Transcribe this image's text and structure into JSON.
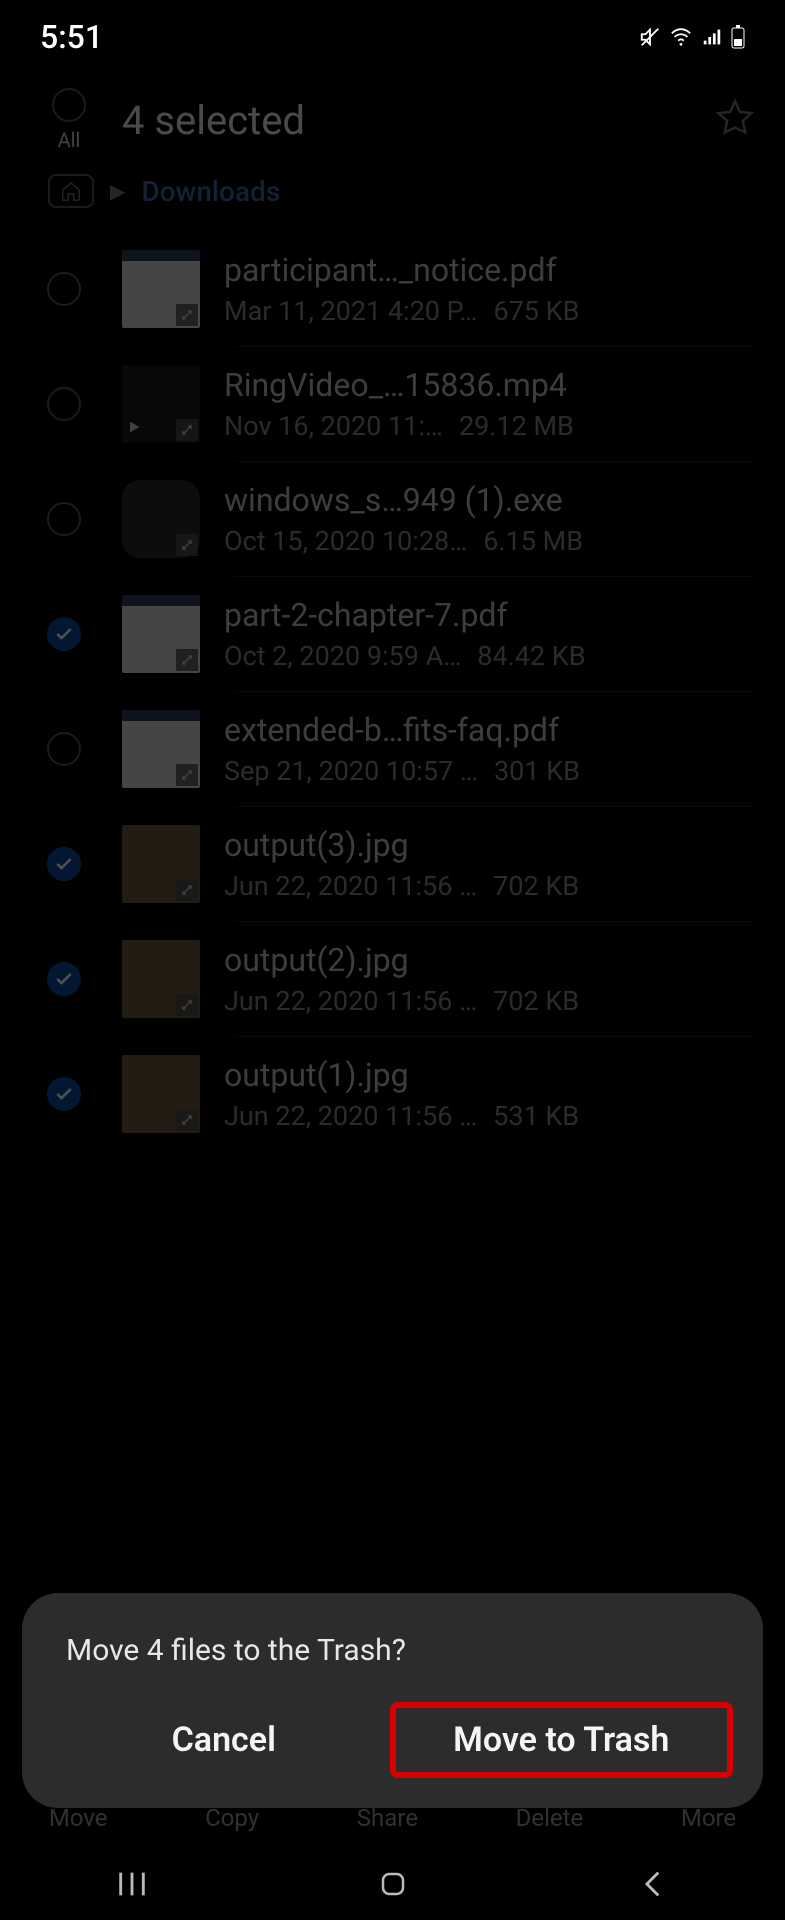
{
  "status": {
    "time": "5:51"
  },
  "header": {
    "title": "4 selected",
    "all_label": "All"
  },
  "breadcrumb": {
    "current": "Downloads"
  },
  "files": [
    {
      "name": "participant…_notice.pdf",
      "date": "Mar 11, 2021 4:20 P…",
      "size": "675 KB",
      "selected": false,
      "kind": "doc"
    },
    {
      "name": "RingVideo_…15836.mp4",
      "date": "Nov 16, 2020 11:…",
      "size": "29.12 MB",
      "selected": false,
      "kind": "vid"
    },
    {
      "name": "windows_s…949 (1).exe",
      "date": "Oct 15, 2020 10:28…",
      "size": "6.15 MB",
      "selected": false,
      "kind": "exe"
    },
    {
      "name": "part-2-chapter-7.pdf",
      "date": "Oct 2, 2020 9:59 A…",
      "size": "84.42 KB",
      "selected": true,
      "kind": "doc"
    },
    {
      "name": "extended-b…fits-faq.pdf",
      "date": "Sep 21, 2020 10:57 …",
      "size": "301 KB",
      "selected": false,
      "kind": "doc"
    },
    {
      "name": "output(3).jpg",
      "date": "Jun 22, 2020 11:56 …",
      "size": "702 KB",
      "selected": true,
      "kind": "img"
    },
    {
      "name": "output(2).jpg",
      "date": "Jun 22, 2020 11:56 …",
      "size": "702 KB",
      "selected": true,
      "kind": "img"
    },
    {
      "name": "output(1).jpg",
      "date": "Jun 22, 2020 11:56 …",
      "size": "531 KB",
      "selected": true,
      "kind": "img"
    }
  ],
  "actions": {
    "move": "Move",
    "copy": "Copy",
    "share": "Share",
    "delete": "Delete",
    "more": "More"
  },
  "dialog": {
    "message": "Move 4 files to the Trash?",
    "cancel": "Cancel",
    "confirm": "Move to Trash"
  }
}
